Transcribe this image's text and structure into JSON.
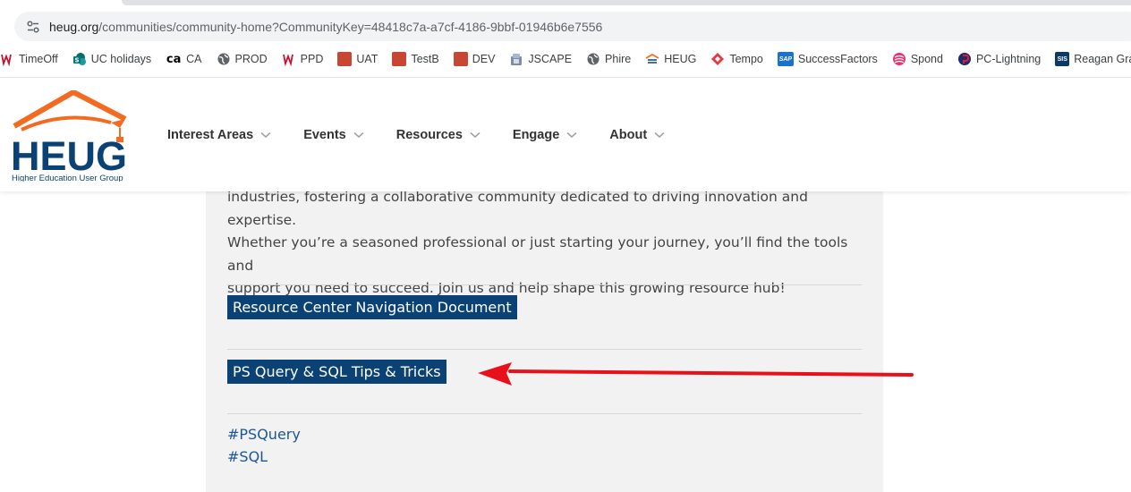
{
  "browser": {
    "url_host": "heug.org",
    "url_path": "/communities/community-home?CommunityKey=48418c7a-a7cf-4186-9bbf-01946b6e7556",
    "bookmarks": [
      {
        "label": "TimeOff",
        "icon": "uc-logo-icon"
      },
      {
        "label": "UC holidays",
        "icon": "sharepoint-icon"
      },
      {
        "label": "CA",
        "icon": "ca-logo-icon"
      },
      {
        "label": "PROD",
        "icon": "globe-icon"
      },
      {
        "label": "PPD",
        "icon": "uc-logo-icon"
      },
      {
        "label": "UAT",
        "icon": "oracle-icon"
      },
      {
        "label": "TestB",
        "icon": "oracle-icon"
      },
      {
        "label": "DEV",
        "icon": "oracle-icon"
      },
      {
        "label": "JSCAPE",
        "icon": "jscape-icon"
      },
      {
        "label": "Phire",
        "icon": "globe-icon"
      },
      {
        "label": "HEUG",
        "icon": "heug-icon"
      },
      {
        "label": "Tempo",
        "icon": "tempo-icon"
      },
      {
        "label": "SuccessFactors",
        "icon": "sap-icon"
      },
      {
        "label": "Spond",
        "icon": "spond-icon"
      },
      {
        "label": "PC-Lightning",
        "icon": "pc-lightning-icon"
      },
      {
        "label": "Reagan Grades",
        "icon": "sis-icon"
      }
    ],
    "bookmark_icon_texts": {
      "ca": "ca",
      "sis": "SIS",
      "sap": "SAP"
    }
  },
  "site": {
    "logo_text": "HEUG",
    "logo_tagline": "Higher Education User Group",
    "nav": [
      {
        "label": "Interest Areas"
      },
      {
        "label": "Events"
      },
      {
        "label": "Resources"
      },
      {
        "label": "Engage"
      },
      {
        "label": "About"
      }
    ]
  },
  "content": {
    "intro_lines": [
      "industries, fostering a collaborative community dedicated to driving innovation and expertise.",
      "Whether you’re a seasoned professional or just starting your journey, you’ll find the tools and",
      "support you need to succeed. Join us and help shape this growing resource hub!"
    ],
    "links": [
      {
        "label": "Resource Center Navigation Document"
      },
      {
        "label": "PS Query & SQL Tips & Tricks"
      }
    ],
    "tags": [
      "#PSQuery",
      "#SQL"
    ]
  },
  "colors": {
    "brand_navy": "#0b4275",
    "brand_orange": "#f26b21",
    "link_blue": "#1b5799",
    "annotation_arrow": "#e8111b"
  }
}
